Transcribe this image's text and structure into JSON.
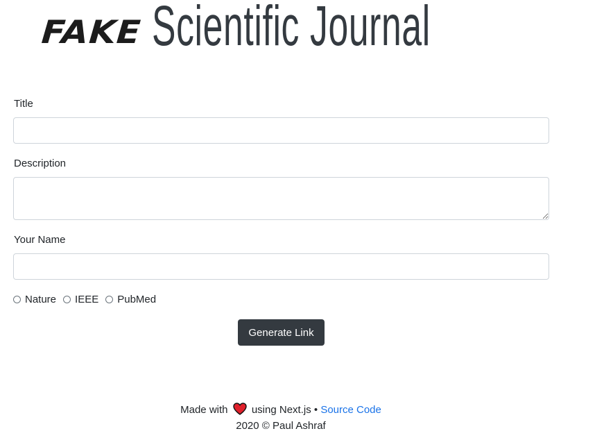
{
  "header": {
    "brand_prefix": "FAKE",
    "brand_title": "Scientific Journal"
  },
  "form": {
    "title_label": "Title",
    "title_value": "",
    "description_label": "Description",
    "description_value": "",
    "name_label": "Your Name",
    "name_value": "",
    "journal_options": [
      "Nature",
      "IEEE",
      "PubMed"
    ],
    "selected_journal": null,
    "generate_label": "Generate Link"
  },
  "footer": {
    "made_with": "Made with",
    "heart_icon": "heart-icon",
    "using_text": "using Next.js •",
    "source_link": "Source Code",
    "copyright": "2020 © Paul Ashraf"
  },
  "colors": {
    "button_bg": "#343a40",
    "link": "#1a73e8",
    "heart": "#e0202b",
    "input_border": "#ced4da"
  }
}
